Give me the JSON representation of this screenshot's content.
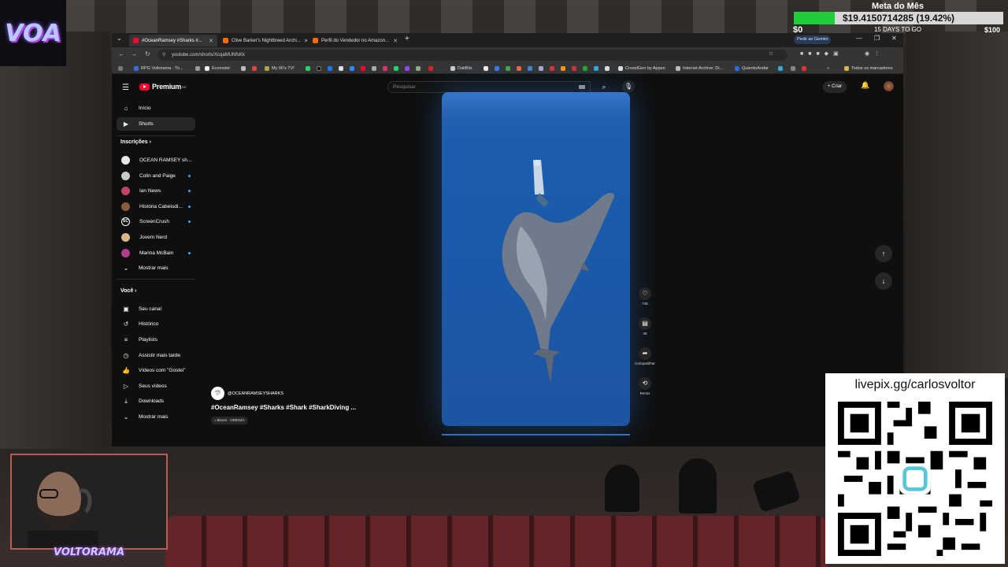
{
  "goal": {
    "title": "Meta do Mês",
    "amount": "$19.4150714285 (19.42%)",
    "progress_percent": 19.42,
    "start": "$0",
    "days_left": "15 DAYS TO GO",
    "target": "$100"
  },
  "browser": {
    "tabs": [
      {
        "title": "#OceanRamsey #Sharks #...",
        "active": true,
        "color": "#ff0033"
      },
      {
        "title": "Clive Barker's Nightbreed Archi...",
        "active": false,
        "color": "#ff6a00"
      },
      {
        "title": "Perfil do Vendedor no Amazon...",
        "active": false,
        "color": "#ff6a00"
      }
    ],
    "gemini_button": "Pedir ao Gemini",
    "url": "youtube.com/shorts/XcqaMUNfsKk",
    "bookmarks": [
      "RPG Voltorama - To...",
      "Ecomster",
      "My 90's TV!",
      "DatiBlix",
      "CrowdGen by Appen",
      "Internet Archive: Di...",
      "QuientoAndar"
    ],
    "all_bookmarks": "Todos os marcadores"
  },
  "youtube": {
    "logo_text": "Premium",
    "logo_region": "BR",
    "search_placeholder": "Pesquisar",
    "create_label": "Criar",
    "sidebar": {
      "main": [
        {
          "label": "Início",
          "icon": "home-icon"
        },
        {
          "label": "Shorts",
          "icon": "shorts-icon"
        }
      ],
      "subscriptions_header": "Inscrições",
      "subscriptions": [
        {
          "label": "OCEAN RAMSEY sh...",
          "color": "#e8e8e8",
          "dot": false
        },
        {
          "label": "Colin and Paige",
          "color": "#c9c9c9",
          "dot": true
        },
        {
          "label": "Ian News",
          "color": "#c0436a",
          "dot": true
        },
        {
          "label": "História Cabeludi...",
          "color": "#8a5a3c",
          "dot": true
        },
        {
          "label": "ScreenCrush",
          "color": "#0f0f0f",
          "dot": true
        },
        {
          "label": "Jovem Nerd",
          "color": "#d9b48a",
          "dot": false
        },
        {
          "label": "Marina McBain",
          "color": "#b03c8a",
          "dot": true
        }
      ],
      "show_more_subs": "Mostrar mais",
      "you_header": "Você",
      "you": [
        {
          "label": "Seu canal",
          "icon": "channel-icon"
        },
        {
          "label": "Histórico",
          "icon": "history-icon"
        },
        {
          "label": "Playlists",
          "icon": "playlist-icon"
        },
        {
          "label": "Assistir mais tarde",
          "icon": "watch-later-icon"
        },
        {
          "label": "Vídeos com \"Gostei\"",
          "icon": "like-icon"
        },
        {
          "label": "Seus vídeos",
          "icon": "video-icon"
        },
        {
          "label": "Downloads",
          "icon": "download-icon"
        }
      ],
      "show_more_you": "Mostrar mais"
    },
    "short": {
      "channel": "@OCEANRAMSEYSHARKS",
      "title": "#OceanRamsey #Sharks #Shark #SharkDiving ...",
      "music": "Bloom · ODESZA",
      "likes": "745",
      "comments": "28",
      "share_label": "Compartilhar",
      "remix_label": "Remix"
    }
  },
  "overlay": {
    "livepix_url": "livepix.gg/carlosvoltor",
    "logo_text": "VOLTORAMA"
  }
}
